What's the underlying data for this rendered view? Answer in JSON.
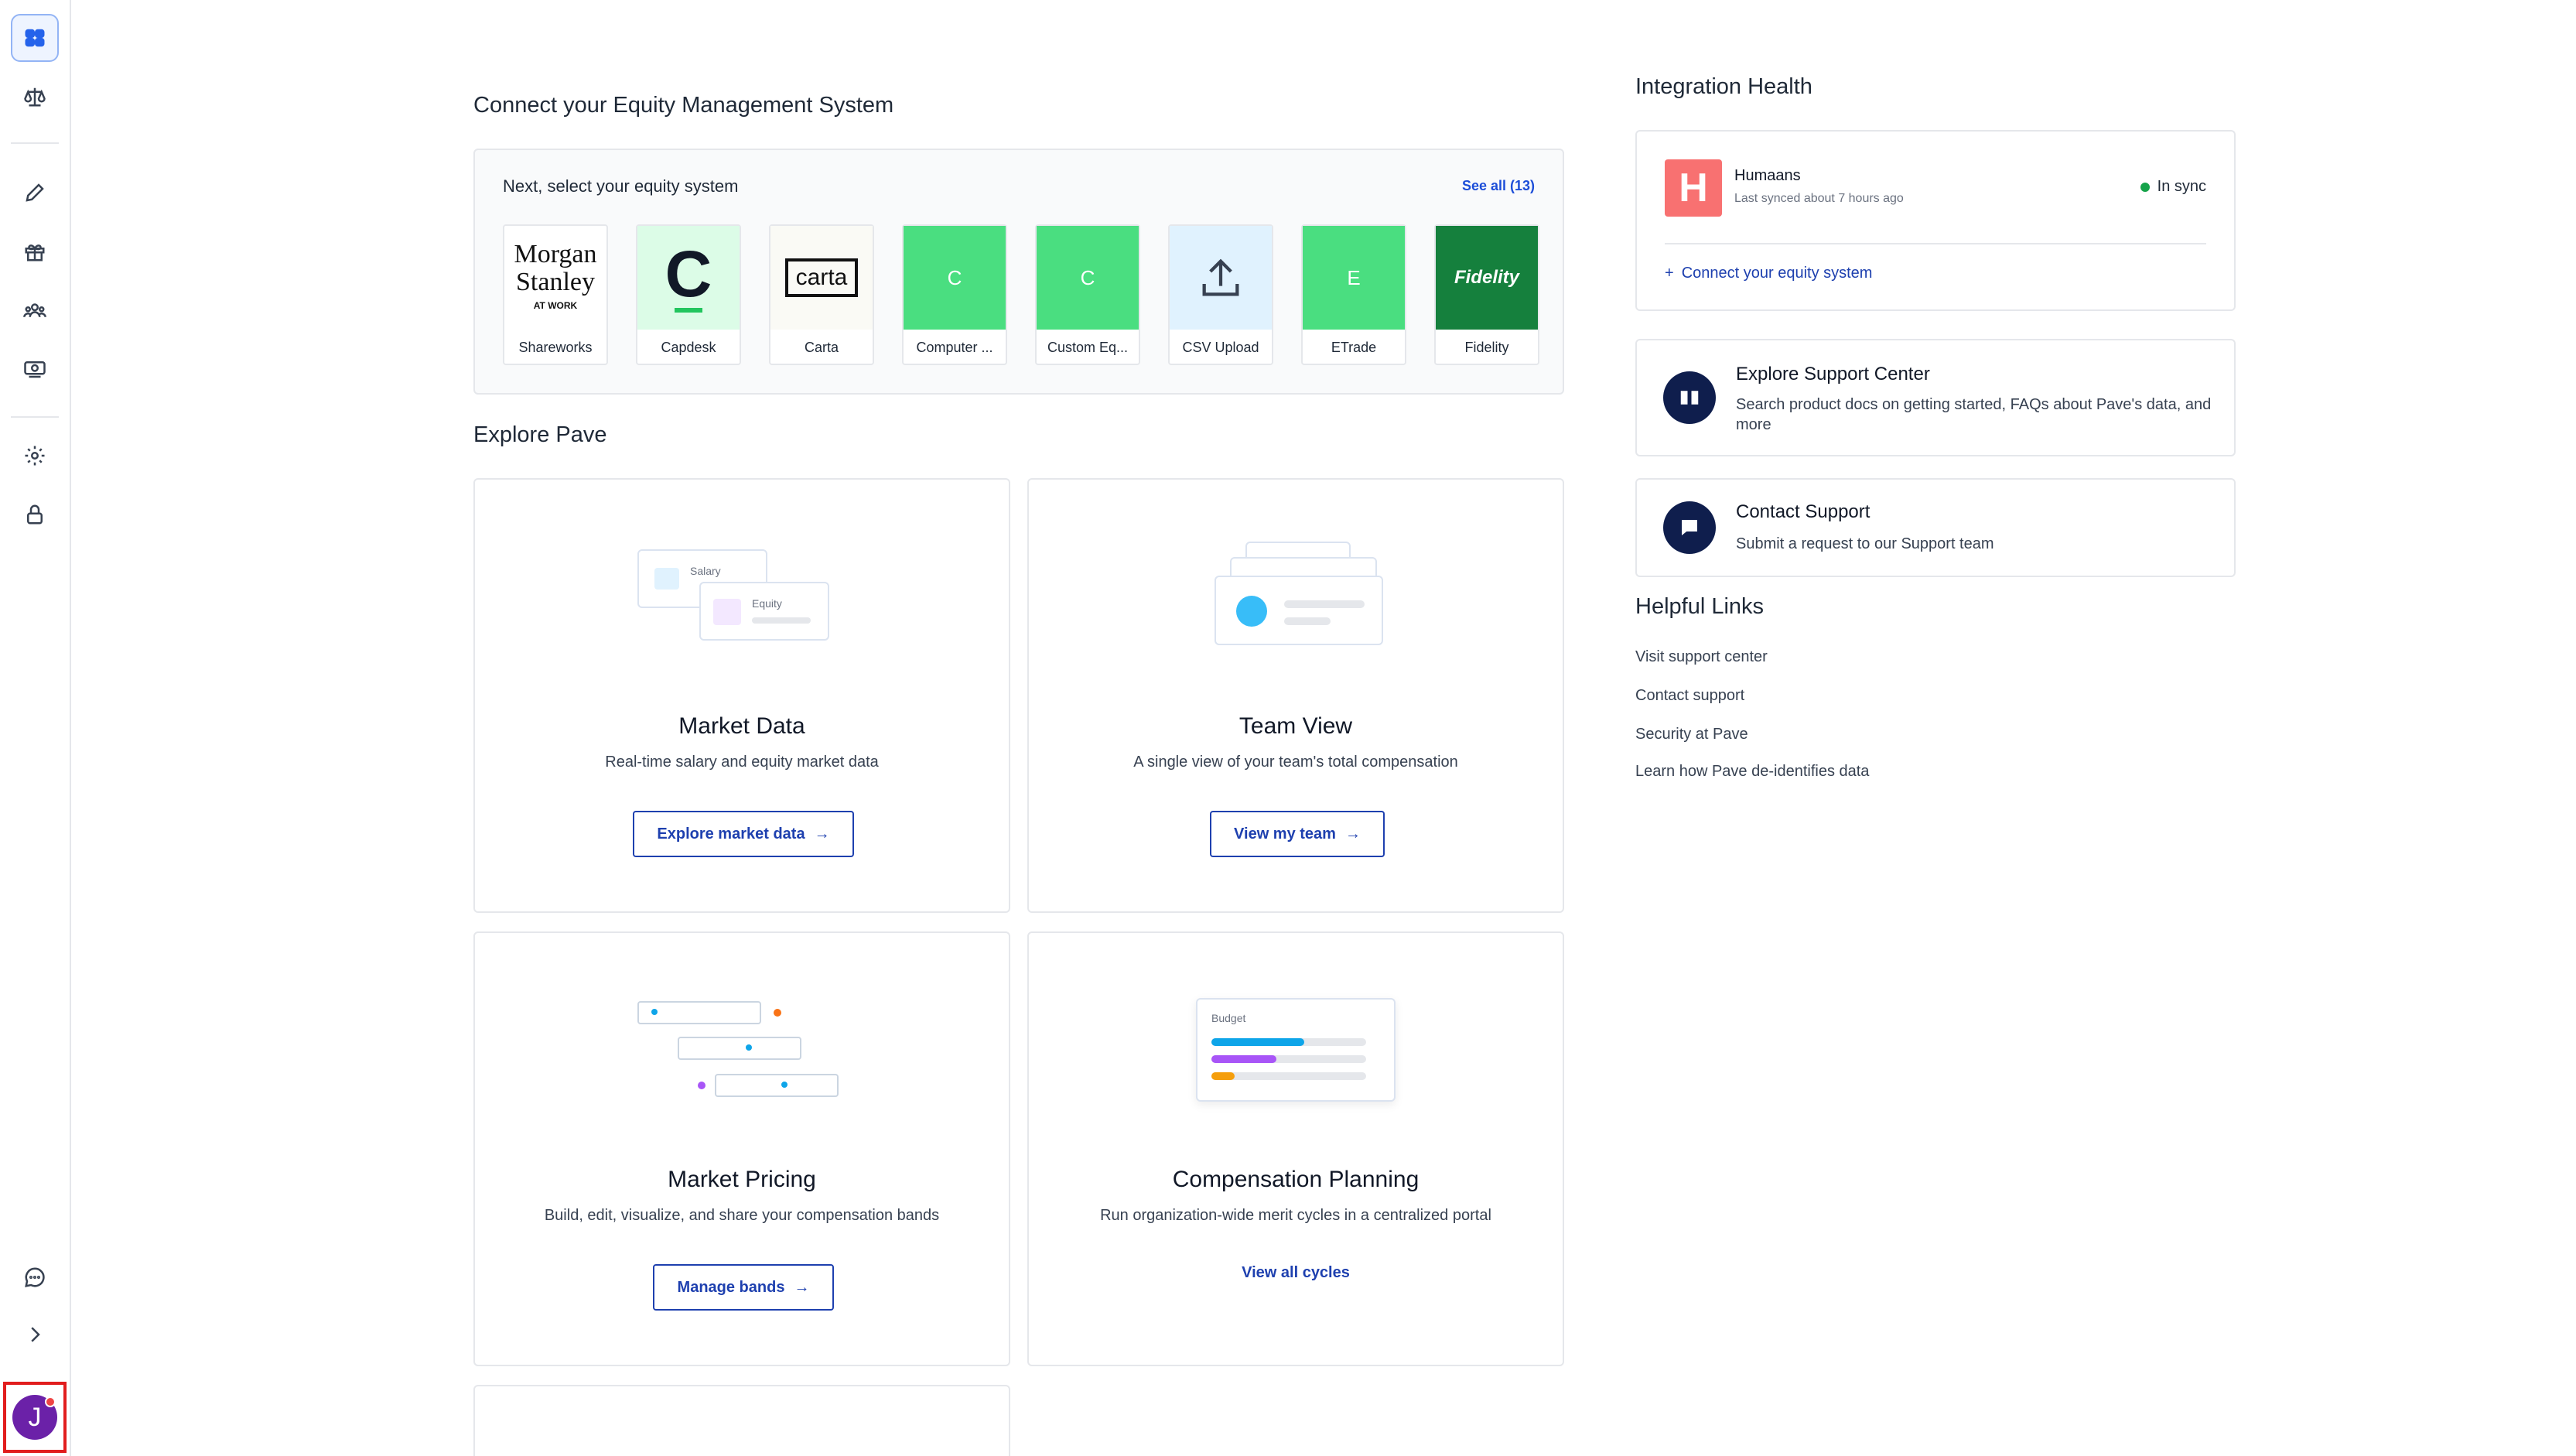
{
  "equity": {
    "heading": "Connect your Equity Management System",
    "subheading": "Next, select your equity system",
    "see_all": "See all (13)",
    "tiles": [
      {
        "name": "Shareworks",
        "logo_line1": "Morgan",
        "logo_line2": "Stanley",
        "logo_line3": "AT WORK"
      },
      {
        "name": "Capdesk",
        "logo_text": "C"
      },
      {
        "name": "Carta",
        "logo_text": "carta"
      },
      {
        "name": "Computer ...",
        "logo_text": "C"
      },
      {
        "name": "Custom Eq...",
        "logo_text": "C"
      },
      {
        "name": "CSV Upload"
      },
      {
        "name": "ETrade",
        "logo_text": "E"
      },
      {
        "name": "Fidelity",
        "logo_text": "Fidelity"
      }
    ]
  },
  "explore": {
    "heading": "Explore Pave",
    "cards": [
      {
        "title": "Market Data",
        "desc": "Real-time salary and equity market data",
        "button": "Explore market data",
        "illus_label1": "Salary",
        "illus_label2": "Equity"
      },
      {
        "title": "Team View",
        "desc": "A single view of your team's total compensation",
        "button": "View my team"
      },
      {
        "title": "Market Pricing",
        "desc": "Build, edit, visualize, and share your compensation bands",
        "button": "Manage bands"
      },
      {
        "title": "Compensation Planning",
        "desc": "Run organization-wide merit cycles in a centralized portal",
        "link": "View all cycles",
        "illus_label": "Budget"
      }
    ]
  },
  "integration": {
    "heading": "Integration Health",
    "provider": "Humaans",
    "provider_initial": "H",
    "last_synced": "Last synced about 7 hours ago",
    "status": "In sync",
    "connect_link": "Connect your equity system"
  },
  "support": {
    "center_title": "Explore Support Center",
    "center_desc": "Search product docs on getting started, FAQs about Pave's data, and more",
    "contact_title": "Contact Support",
    "contact_desc": "Submit a request to our Support team"
  },
  "helpful": {
    "heading": "Helpful Links",
    "links": [
      "Visit support center",
      "Contact support",
      "Security at Pave",
      "Learn how Pave de-identifies data"
    ]
  },
  "user": {
    "initial": "J"
  },
  "colors": {
    "accent": "#1e40af",
    "sidebar_active": "#2563eb",
    "tile_green": "#4ade80",
    "fidelity_green": "#15803d",
    "humaans": "#f87171",
    "sync_green": "#16a34a",
    "avatar": "#6b21a8"
  }
}
